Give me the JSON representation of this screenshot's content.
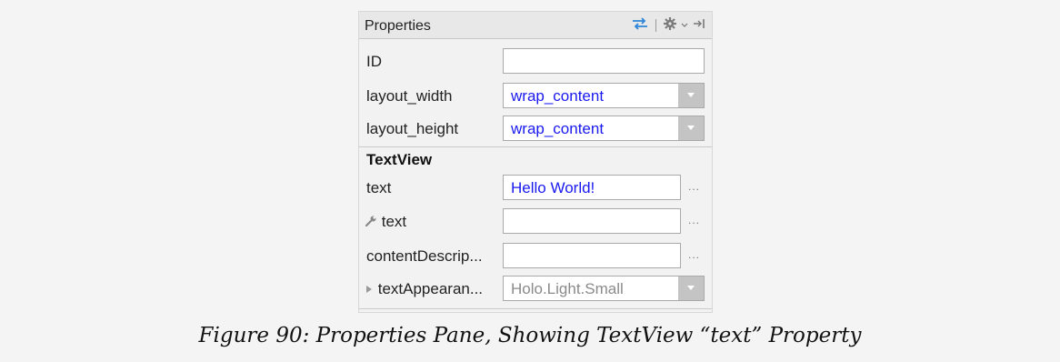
{
  "panel": {
    "title": "Properties",
    "icons": [
      "swap-arrows-icon",
      "gear-icon",
      "chevron-down-icon",
      "pin-icon"
    ]
  },
  "rows": {
    "id": {
      "label": "ID",
      "value": ""
    },
    "layout_width": {
      "label": "layout_width",
      "value": "wrap_content"
    },
    "layout_height": {
      "label": "layout_height",
      "value": "wrap_content"
    }
  },
  "section": {
    "title": "TextView"
  },
  "textview_rows": {
    "text": {
      "label": "text",
      "value": "Hello World!",
      "more": "..."
    },
    "tools_text": {
      "label": "text",
      "value": "",
      "more": "..."
    },
    "content_description": {
      "label": "contentDescrip...",
      "value": "",
      "more": "..."
    },
    "text_appearance": {
      "label": "textAppearan...",
      "value": "Holo.Light.Small"
    }
  },
  "caption": "Figure 90: Properties Pane, Showing TextView “text” Property",
  "colors": {
    "value_text": "#1a1af0",
    "disabled_value_text": "#8a8a8a",
    "swap_icon": "#2e86d8"
  }
}
